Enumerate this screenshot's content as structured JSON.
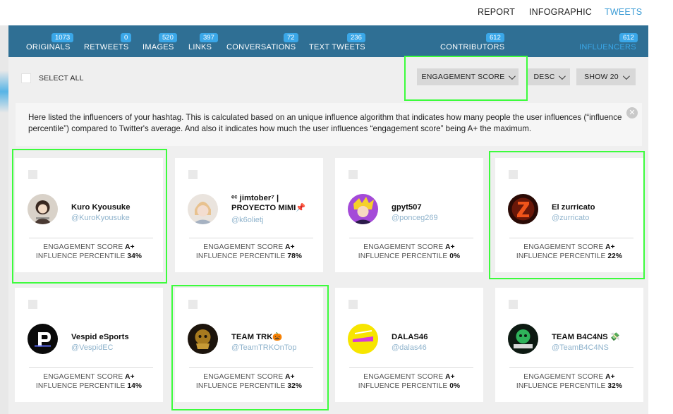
{
  "topnav": {
    "report": "REPORT",
    "infographic": "INFOGRAPHIC",
    "tweets": "TWEETS"
  },
  "tabs": [
    {
      "label": "ORIGINALS",
      "count": "1073"
    },
    {
      "label": "RETWEETS",
      "count": "0"
    },
    {
      "label": "IMAGES",
      "count": "520"
    },
    {
      "label": "LINKS",
      "count": "397"
    },
    {
      "label": "CONVERSATIONS",
      "count": "72"
    },
    {
      "label": "TEXT TWEETS",
      "count": "236"
    },
    {
      "label": "CONTRIBUTORS",
      "count": "612"
    },
    {
      "label": "INFLUENCERS",
      "count": "612"
    }
  ],
  "toolbar": {
    "select_all": "SELECT ALL",
    "sort_by": "ENGAGEMENT SCORE",
    "order": "DESC",
    "show": "SHOW 20"
  },
  "info": {
    "text": "Here listed the influencers of your hashtag. This is calculated based on an unique influence algorithm that indicates how many people the user influences (“influence percentile”) compared to Twitter's average. And also it indicates how much the user influences “engagement score” being A+ the maximum."
  },
  "labels": {
    "engagement": "ENGAGEMENT SCORE",
    "influence": "INFLUENCE PERCENTILE"
  },
  "cards": [
    {
      "name": "Kuro Kyousuke",
      "handle": "@KuroKyousuke",
      "engagement": "A+",
      "influence": "34%"
    },
    {
      "name": "ᵉᶜ jimtober⁷ | PROYECTO MIMI📌",
      "handle": "@k6olietj",
      "engagement": "A+",
      "influence": "78%"
    },
    {
      "name": "gpyt507",
      "handle": "@ponceg269",
      "engagement": "A+",
      "influence": "0%"
    },
    {
      "name": "El zurricato",
      "handle": "@zurricato",
      "engagement": "A+",
      "influence": "22%"
    },
    {
      "name": "Vespid eSports",
      "handle": "@VespidEC",
      "engagement": "A+",
      "influence": "14%"
    },
    {
      "name": "TEAM TRK🎃",
      "handle": "@TeamTRKOnTop",
      "engagement": "A+",
      "influence": "32%"
    },
    {
      "name": "DALAS46",
      "handle": "@dalas46",
      "engagement": "A+",
      "influence": "0%"
    },
    {
      "name": "TEAM B4C4NS 💸",
      "handle": "@TeamB4C4NS",
      "engagement": "A+",
      "influence": "32%"
    }
  ],
  "colors": {
    "tabbar": "#2f6f94",
    "accent": "#3aa7e8",
    "highlight": "#3dfc3d"
  }
}
